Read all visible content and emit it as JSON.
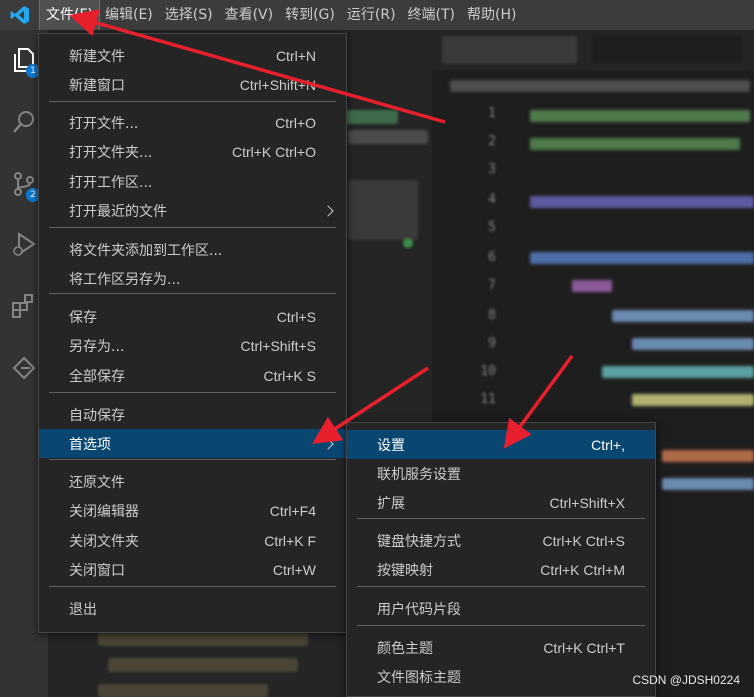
{
  "menubar": {
    "items": [
      "文件(F)",
      "编辑(E)",
      "选择(S)",
      "查看(V)",
      "转到(G)",
      "运行(R)",
      "终端(T)",
      "帮助(H)"
    ]
  },
  "activity": {
    "explorer_badge": "1",
    "scm_badge": "2"
  },
  "file_menu": {
    "items": [
      {
        "label": "新建文件",
        "shortcut": "Ctrl+N"
      },
      {
        "label": "新建窗口",
        "shortcut": "Ctrl+Shift+N"
      },
      {
        "label": "打开文件...",
        "shortcut": "Ctrl+O"
      },
      {
        "label": "打开文件夹...",
        "shortcut": "Ctrl+K Ctrl+O"
      },
      {
        "label": "打开工作区...",
        "shortcut": ""
      },
      {
        "label": "打开最近的文件",
        "shortcut": ""
      },
      {
        "label": "将文件夹添加到工作区...",
        "shortcut": ""
      },
      {
        "label": "将工作区另存为...",
        "shortcut": ""
      },
      {
        "label": "保存",
        "shortcut": "Ctrl+S"
      },
      {
        "label": "另存为...",
        "shortcut": "Ctrl+Shift+S"
      },
      {
        "label": "全部保存",
        "shortcut": "Ctrl+K S"
      },
      {
        "label": "自动保存",
        "shortcut": ""
      },
      {
        "label": "首选项",
        "shortcut": ""
      },
      {
        "label": "还原文件",
        "shortcut": ""
      },
      {
        "label": "关闭编辑器",
        "shortcut": "Ctrl+F4"
      },
      {
        "label": "关闭文件夹",
        "shortcut": "Ctrl+K F"
      },
      {
        "label": "关闭窗口",
        "shortcut": "Ctrl+W"
      },
      {
        "label": "退出",
        "shortcut": ""
      }
    ]
  },
  "prefs_menu": {
    "items": [
      {
        "label": "设置",
        "shortcut": "Ctrl+,"
      },
      {
        "label": "联机服务设置",
        "shortcut": ""
      },
      {
        "label": "扩展",
        "shortcut": "Ctrl+Shift+X"
      },
      {
        "label": "键盘快捷方式",
        "shortcut": "Ctrl+K Ctrl+S"
      },
      {
        "label": "按键映射",
        "shortcut": "Ctrl+K Ctrl+M"
      },
      {
        "label": "用户代码片段",
        "shortcut": ""
      },
      {
        "label": "颜色主题",
        "shortcut": "Ctrl+K Ctrl+T"
      },
      {
        "label": "文件图标主题",
        "shortcut": ""
      }
    ]
  },
  "editor": {
    "line_numbers": [
      "1",
      "2",
      "3",
      "4",
      "5",
      "6",
      "7",
      "8",
      "9",
      "10",
      "11"
    ]
  },
  "watermark": "CSDN @JDSH0224",
  "colors": {
    "menubar_bg": "#3c3c3c",
    "menu_bg": "#252526",
    "selection": "#094771",
    "annotation_arrow": "#e8202e",
    "badge": "#0e7ad3"
  }
}
